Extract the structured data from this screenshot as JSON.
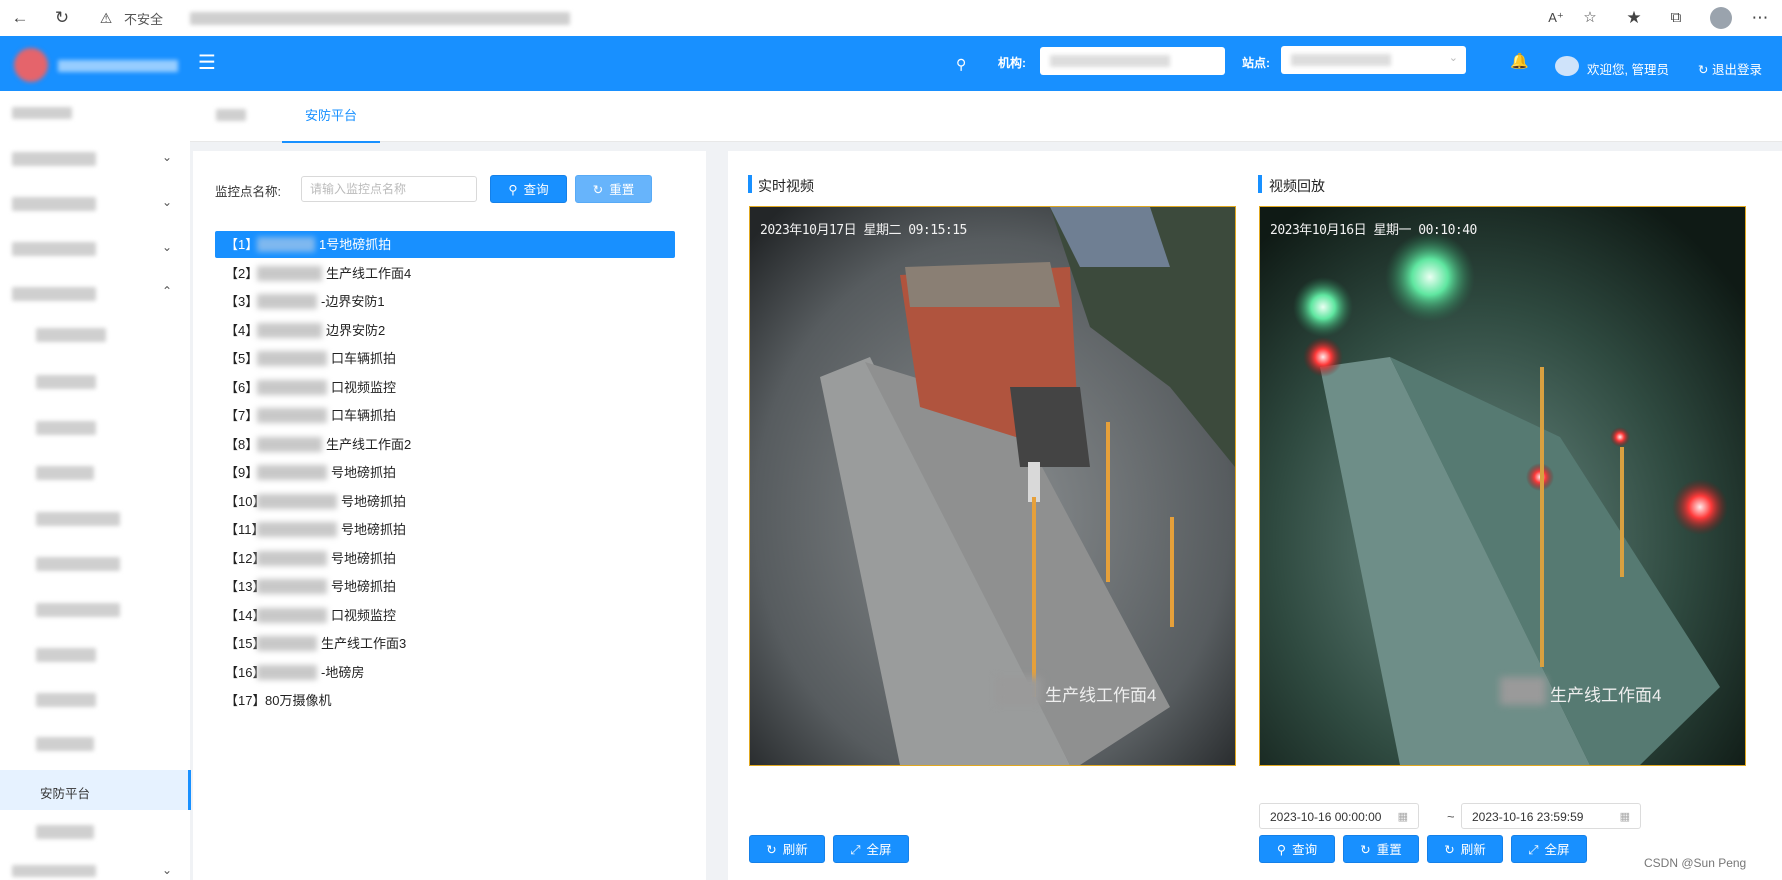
{
  "browser": {
    "security_label": "不安全"
  },
  "header": {
    "org_label": "机构:",
    "site_label": "站点:",
    "welcome": "欢迎您, 管理员",
    "logout": "退出登录"
  },
  "tabs": {
    "active": "安防平台"
  },
  "sidebar": {
    "active_item": "安防平台"
  },
  "search": {
    "label": "监控点名称:",
    "placeholder": "请输入监控点名称",
    "query_button": "查询",
    "reset_button": "重置"
  },
  "cameras": [
    {
      "index": "【1】",
      "name": "1号地磅抓拍"
    },
    {
      "index": "【2】",
      "name": "生产线工作面4"
    },
    {
      "index": "【3】",
      "name": "-边界安防1"
    },
    {
      "index": "【4】",
      "name": "边界安防2"
    },
    {
      "index": "【5】",
      "name": "口车辆抓拍"
    },
    {
      "index": "【6】",
      "name": "口视频监控"
    },
    {
      "index": "【7】",
      "name": "口车辆抓拍"
    },
    {
      "index": "【8】",
      "name": "生产线工作面2"
    },
    {
      "index": "【9】",
      "name": "号地磅抓拍"
    },
    {
      "index": "【10】",
      "name": "号地磅抓拍"
    },
    {
      "index": "【11】",
      "name": "号地磅抓拍"
    },
    {
      "index": "【12】",
      "name": "号地磅抓拍"
    },
    {
      "index": "【13】",
      "name": "号地磅抓拍"
    },
    {
      "index": "【14】",
      "name": "口视频监控"
    },
    {
      "index": "【15】",
      "name": "生产线工作面3"
    },
    {
      "index": "【16】",
      "name": "-地磅房"
    },
    {
      "index": "【17】",
      "name": "80万摄像机"
    }
  ],
  "live": {
    "title": "实时视频",
    "timestamp": "2023年10月17日 星期二 09:15:15",
    "location_text": "生产线工作面4",
    "refresh_button": "刷新",
    "fullscreen_button": "全屏"
  },
  "playback": {
    "title": "视频回放",
    "timestamp": "2023年10月16日 星期一 00:10:40",
    "location_text": "生产线工作面4",
    "start_time": "2023-10-16 00:00:00",
    "end_time": "2023-10-16 23:59:59",
    "range_separator": "~",
    "query_button": "查询",
    "reset_button": "重置",
    "refresh_button": "刷新",
    "fullscreen_button": "全屏"
  },
  "watermark": "CSDN @Sun  Peng"
}
